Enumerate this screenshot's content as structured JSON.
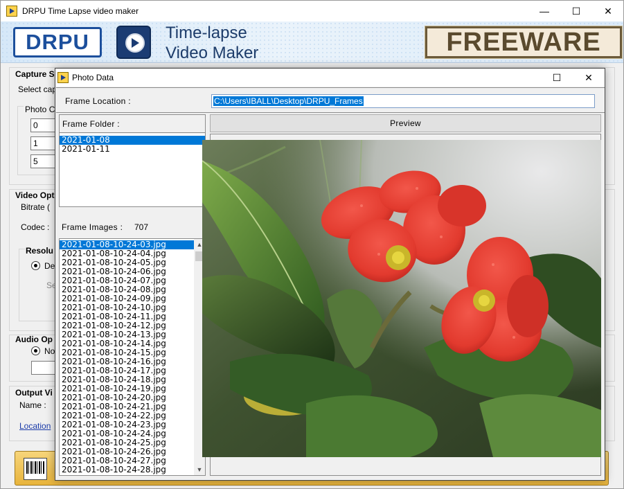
{
  "main_window": {
    "title": "DRPU Time Lapse video maker",
    "controls": {
      "minimize": "—",
      "maximize": "☐",
      "close": "✕"
    },
    "banner": {
      "logo_text": "DRPU",
      "product_line1": "Time-lapse",
      "product_line2": "Video Maker",
      "badge": "FREEWARE"
    },
    "partial_labels": {
      "capture": "Capture S",
      "select": "Select cap",
      "photo": "Photo C",
      "field1": "0",
      "field2": "1",
      "field3": "5",
      "video_options": "Video Opt",
      "bitrate": "Bitrate (",
      "codec": "Codec :",
      "resolution": "Resolu",
      "radio_de": "De",
      "se": "Se",
      "audio": "Audio Op",
      "radio_no": "No",
      "output": "Output Vi",
      "name": "Name :",
      "location_link": "Location"
    }
  },
  "dialog": {
    "title": "Photo Data",
    "controls": {
      "maximize": "☐",
      "close": "✕"
    },
    "frame_location_label": "Frame Location :",
    "frame_location_value": "C:\\Users\\IBALL\\Desktop\\DRPU_Frames",
    "frame_folder_label": "Frame Folder :",
    "folders": [
      "2021-01-08",
      "2021-01-11"
    ],
    "selected_folder_index": 0,
    "frame_images_label": "Frame Images :",
    "frame_images_count": "707",
    "images": [
      "2021-01-08-10-24-03.jpg",
      "2021-01-08-10-24-04.jpg",
      "2021-01-08-10-24-05.jpg",
      "2021-01-08-10-24-06.jpg",
      "2021-01-08-10-24-07.jpg",
      "2021-01-08-10-24-08.jpg",
      "2021-01-08-10-24-09.jpg",
      "2021-01-08-10-24-10.jpg",
      "2021-01-08-10-24-11.jpg",
      "2021-01-08-10-24-12.jpg",
      "2021-01-08-10-24-13.jpg",
      "2021-01-08-10-24-14.jpg",
      "2021-01-08-10-24-15.jpg",
      "2021-01-08-10-24-16.jpg",
      "2021-01-08-10-24-17.jpg",
      "2021-01-08-10-24-18.jpg",
      "2021-01-08-10-24-19.jpg",
      "2021-01-08-10-24-20.jpg",
      "2021-01-08-10-24-21.jpg",
      "2021-01-08-10-24-22.jpg",
      "2021-01-08-10-24-23.jpg",
      "2021-01-08-10-24-24.jpg",
      "2021-01-08-10-24-25.jpg",
      "2021-01-08-10-24-26.jpg",
      "2021-01-08-10-24-27.jpg",
      "2021-01-08-10-24-28.jpg"
    ],
    "selected_image_index": 0,
    "preview_label": "Preview"
  },
  "colors": {
    "selection": "#0078d7",
    "banner_blue": "#1c4f9c",
    "freeware_text": "#5a4a2e",
    "footer_gold": "#e8b43c",
    "flower_red": "#e23a2e"
  }
}
